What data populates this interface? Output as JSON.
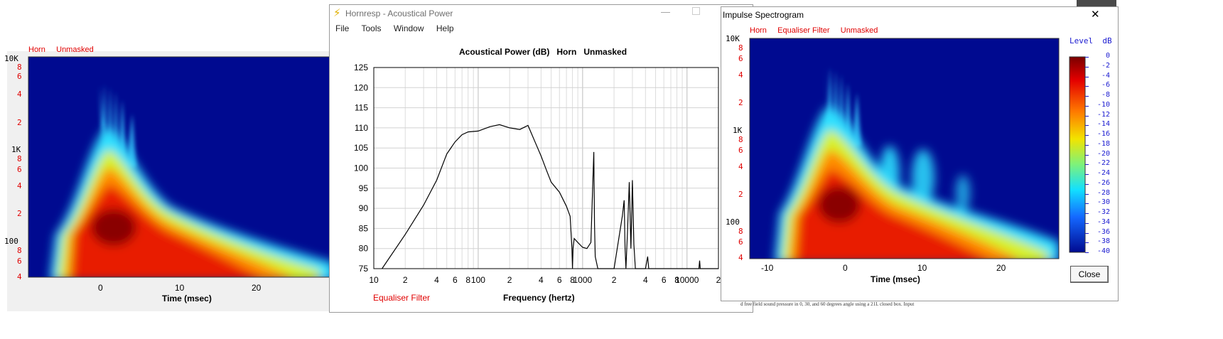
{
  "left_window": {
    "header_labels": [
      "Horn",
      "Unmasked"
    ],
    "y_ticks": [
      {
        "label": "10K",
        "kind": "main"
      },
      {
        "label": "8",
        "kind": "minor"
      },
      {
        "label": "6",
        "kind": "minor"
      },
      {
        "label": "4",
        "kind": "minor"
      },
      {
        "label": "2",
        "kind": "minor"
      },
      {
        "label": "1K",
        "kind": "main"
      },
      {
        "label": "8",
        "kind": "minor"
      },
      {
        "label": "6",
        "kind": "minor"
      },
      {
        "label": "4",
        "kind": "minor"
      },
      {
        "label": "2",
        "kind": "minor"
      },
      {
        "label": "100",
        "kind": "main"
      },
      {
        "label": "8",
        "kind": "minor"
      },
      {
        "label": "6",
        "kind": "minor"
      },
      {
        "label": "4",
        "kind": "minor"
      }
    ],
    "x_ticks": [
      "0",
      "10",
      "20"
    ],
    "xlabel": "Time (msec)"
  },
  "main_window": {
    "title": "Hornresp - Acoustical Power",
    "title_icon": "lightning-icon",
    "menu": [
      "File",
      "Tools",
      "Window",
      "Help"
    ],
    "chart_title": "Acoustical Power (dB)   Horn   Unmasked",
    "footer_left": "Equaliser Filter",
    "xlabel": "Frequency (hertz)",
    "x_ticks": [
      "10",
      "2",
      "4",
      "6",
      "8",
      "100",
      "2",
      "4",
      "6",
      "8",
      "1000",
      "2",
      "4",
      "6",
      "8",
      "10000",
      "2"
    ],
    "y_ticks": [
      "125",
      "120",
      "115",
      "110",
      "105",
      "100",
      "95",
      "90",
      "85",
      "80",
      "75"
    ],
    "colors": {
      "accent_red": "#e00000",
      "curve": "#000000"
    }
  },
  "chart_data": {
    "type": "line",
    "title": "Acoustical Power (dB)   Horn   Unmasked",
    "xlabel": "Frequency (hertz)",
    "ylabel": "",
    "xscale": "log",
    "xlim": [
      10,
      20000
    ],
    "ylim": [
      75,
      125
    ],
    "grid": true,
    "series": [
      {
        "x": [
          12,
          20,
          30,
          40,
          50,
          60,
          70,
          80,
          100,
          130,
          160,
          200,
          250,
          300,
          350,
          400,
          450,
          500,
          600,
          700,
          760,
          790,
          800,
          810,
          830,
          900,
          1000,
          1100,
          1200,
          1280,
          1300,
          1320,
          1400,
          2000,
          2400,
          2500,
          2550,
          2600,
          2700,
          2800,
          2900,
          3000,
          3100,
          3200,
          3400,
          3600,
          4000,
          4200,
          4300,
          4400,
          5000,
          6000,
          7000,
          8000,
          9000,
          10000,
          13000,
          13200,
          13400,
          20000
        ],
        "y": [
          75,
          83.5,
          90.8,
          97,
          103.5,
          106.5,
          108.3,
          109,
          109.2,
          110.3,
          110.8,
          110,
          109.6,
          110.6,
          106.5,
          103,
          99.5,
          96.5,
          94,
          90.5,
          88,
          80,
          75,
          80,
          82.5,
          81.5,
          80.3,
          80,
          81.5,
          104,
          86,
          78,
          75,
          75,
          88,
          92,
          80,
          75,
          85,
          96.5,
          80,
          97,
          81,
          75,
          75,
          75,
          75,
          78,
          75,
          75,
          75,
          75,
          75,
          75,
          75,
          75,
          75,
          77,
          75,
          75
        ]
      }
    ]
  },
  "spectrogram_window": {
    "title": "Impulse Spectrogram",
    "header_labels": [
      "Horn",
      "Equaliser Filter",
      "Unmasked"
    ],
    "y_ticks": [
      {
        "label": "10K",
        "kind": "main"
      },
      {
        "label": "8",
        "kind": "minor"
      },
      {
        "label": "6",
        "kind": "minor"
      },
      {
        "label": "4",
        "kind": "minor"
      },
      {
        "label": "2",
        "kind": "minor"
      },
      {
        "label": "1K",
        "kind": "main"
      },
      {
        "label": "8",
        "kind": "minor"
      },
      {
        "label": "6",
        "kind": "minor"
      },
      {
        "label": "4",
        "kind": "minor"
      },
      {
        "label": "2",
        "kind": "minor"
      },
      {
        "label": "100",
        "kind": "main"
      },
      {
        "label": "8",
        "kind": "minor"
      },
      {
        "label": "6",
        "kind": "minor"
      },
      {
        "label": "4",
        "kind": "minor"
      }
    ],
    "x_ticks": [
      "-10",
      "0",
      "10",
      "20"
    ],
    "xlabel": "Time (msec)",
    "level_label": "Level",
    "level_unit": "dB",
    "level_ticks": [
      "0",
      "-2",
      "-4",
      "-6",
      "-8",
      "-10",
      "-12",
      "-14",
      "-16",
      "-18",
      "-20",
      "-22",
      "-24",
      "-26",
      "-28",
      "-30",
      "-32",
      "-34",
      "-36",
      "-38",
      "-40"
    ],
    "close_label": "Close",
    "bottom_text": "d free field sound pressure in 0, 30, and 60 degrees angle using a 21L closed box. Input"
  }
}
